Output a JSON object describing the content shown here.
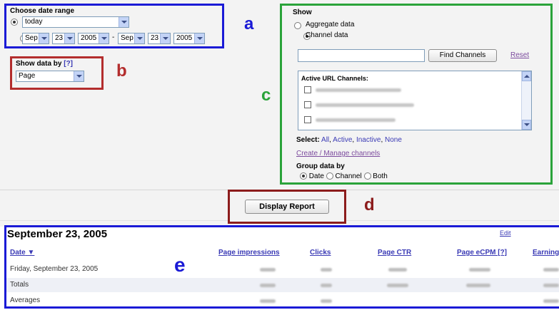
{
  "date_range": {
    "heading": "Choose date range",
    "preset_value": "today",
    "custom": {
      "from_month": "Sep",
      "from_day": "23",
      "from_year": "2005",
      "separator": "-",
      "to_month": "Sep",
      "to_day": "23",
      "to_year": "2005"
    }
  },
  "show_by": {
    "heading": "Show data by",
    "help": "[?]",
    "value": "Page"
  },
  "show": {
    "heading": "Show",
    "option_aggregate": "Aggregate data",
    "option_channel": "Channel data",
    "find_button": "Find Channels",
    "reset_link": "Reset",
    "list_header": "Active URL Channels:",
    "select_label": "Select:",
    "select_links": [
      "All",
      "Active",
      "Inactive",
      "None"
    ],
    "manage_link": "Create / Manage channels",
    "group_heading": "Group data by",
    "group_options": [
      "Date",
      "Channel",
      "Both"
    ]
  },
  "display_report_button": "Display Report",
  "report": {
    "title": "September 23, 2005",
    "edit_link": "Edit",
    "columns": [
      "Date",
      "Page impressions",
      "Clicks",
      "Page CTR",
      "Page eCPM [?]",
      "Earnings"
    ],
    "rows": [
      {
        "label": "Friday, September 23, 2005"
      },
      {
        "label": "Totals"
      },
      {
        "label": "Averages"
      }
    ]
  },
  "annotations": [
    "a",
    "b",
    "c",
    "d",
    "e"
  ],
  "colors": {
    "box_a": "#1a1ad6",
    "box_b": "#b32d2d",
    "box_c": "#2aa33a",
    "box_d": "#8c1c1c",
    "box_e": "#1a1ad6"
  }
}
